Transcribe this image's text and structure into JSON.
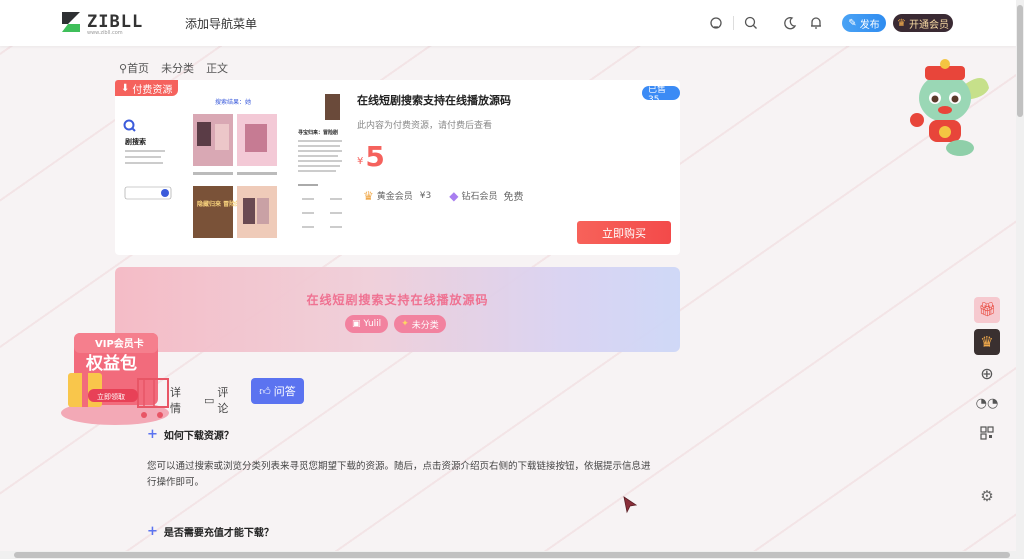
{
  "header": {
    "logo_text": "ZIBLL",
    "logo_sub": "www.zibll.com",
    "nav_add": "添加导航菜单",
    "publish_label": "发布",
    "vip_label": "开通会员",
    "icons": [
      "theme-icon",
      "search-icon",
      "moon-icon",
      "bell-icon"
    ]
  },
  "breadcrumb": {
    "home": "首页",
    "category": "未分类",
    "current": "正文"
  },
  "product": {
    "paid_tag": "付费资源",
    "sold": "已售 35",
    "title": "在线短剧搜索支持在线播放源码",
    "desc": "此内容为付费资源，请付费后查看",
    "currency": "¥",
    "price": "5",
    "gold_member": "黄金会员",
    "gold_price": "¥3",
    "diamond_member": "钻石会员",
    "diamond_price": "免费",
    "buy_label": "立即购买",
    "thumb_title": "搜索结果：她",
    "thumb_search": "剧搜索",
    "thumb_right_title": "寻宝归来：冒险剧",
    "thumb_poster_text": "隐藏归来 冒险的你"
  },
  "banner": {
    "title": "在线短剧搜索支持在线播放源码",
    "tag_author": "Yulil",
    "tag_category": "未分类"
  },
  "tabs": {
    "detail": "详情",
    "comments": "评论",
    "qa": "问答"
  },
  "faq": {
    "q1": "如何下载资源？",
    "a1": "您可以通过搜索或浏览分类列表来寻觅您期望下载的资源。随后，点击资源介绍页右侧的下载链接按钮，依据提示信息进行操作即可。",
    "q2": "是否需要充值才能下载？"
  },
  "vip_promo": {
    "line1": "VIP会员卡",
    "line2": "权益包",
    "cta": "立即领取"
  },
  "colors": {
    "accent": "#5b73f0",
    "price": "#f5625d",
    "publish": "#2f8cf0",
    "vip_bg": "#3a2a33",
    "banner_pink": "#f27c9b"
  }
}
